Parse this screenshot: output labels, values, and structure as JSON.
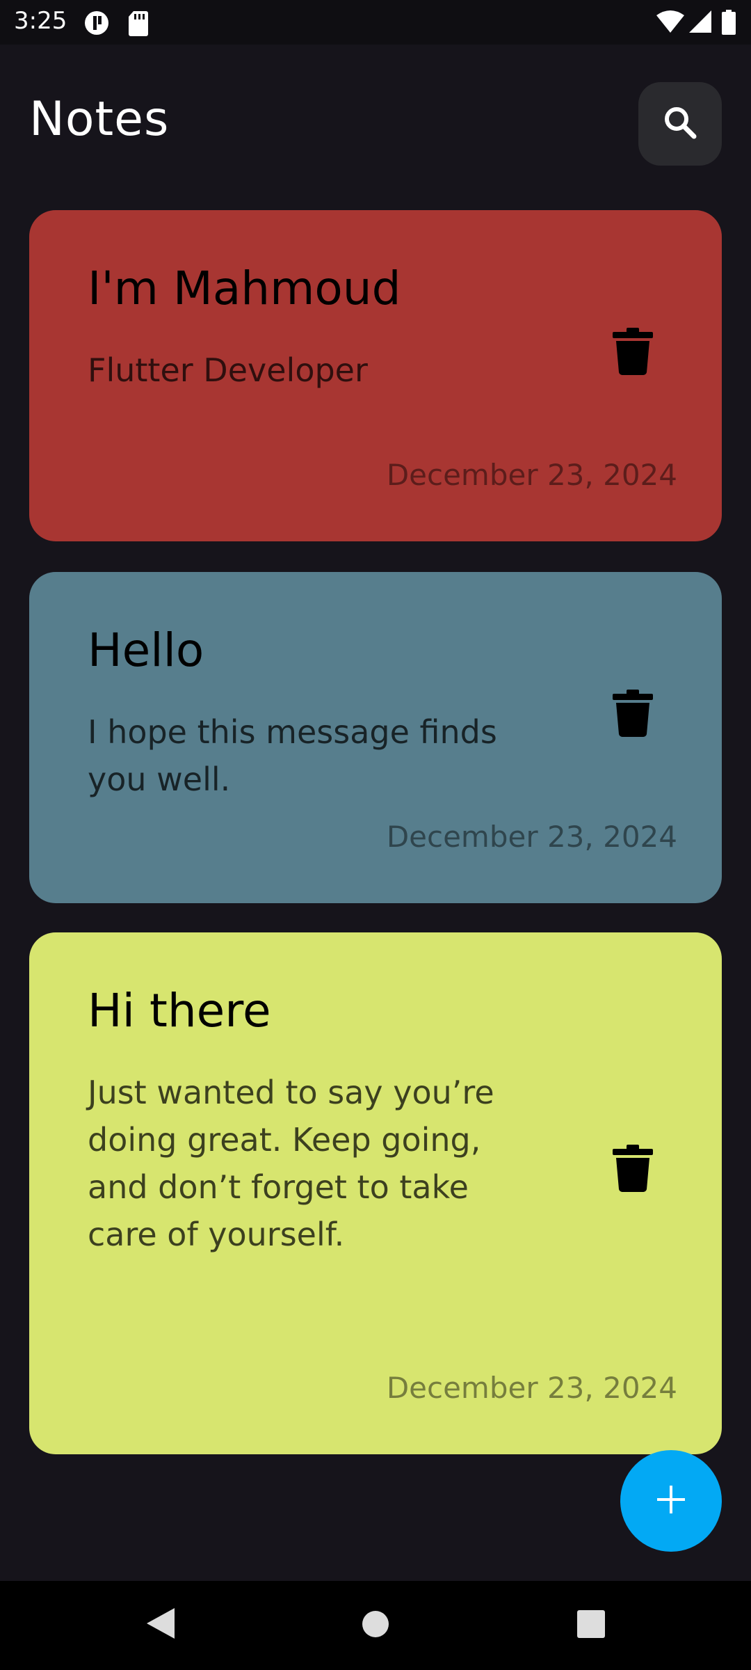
{
  "status_bar": {
    "time": "3:25",
    "icons": [
      "notification-app-icon",
      "sd-card-icon",
      "wifi-icon",
      "signal-icon",
      "battery-icon"
    ]
  },
  "app_bar": {
    "title": "Notes",
    "search_icon": "search-icon"
  },
  "notes": [
    {
      "title": "I'm Mahmoud",
      "body": "Flutter Developer",
      "date": "December 23, 2024",
      "color": "#a83632",
      "delete_icon": "trash-icon"
    },
    {
      "title": "Hello",
      "body": "I hope this message finds you well.",
      "date": "December 23, 2024",
      "color": "#577e8d",
      "delete_icon": "trash-icon"
    },
    {
      "title": "Hi there",
      "body": "Just wanted to say you’re doing great. Keep going, and don’t forget to take care of yourself.",
      "date": "December 23, 2024",
      "color": "#d7e56f",
      "delete_icon": "trash-icon"
    }
  ],
  "fab": {
    "icon": "plus-icon",
    "color": "#03a9f4"
  },
  "nav_bar": {
    "icons": [
      "back-icon",
      "home-icon",
      "recents-icon"
    ]
  },
  "colors": {
    "background": "#16141b",
    "search_button": "#2a2a2e"
  }
}
